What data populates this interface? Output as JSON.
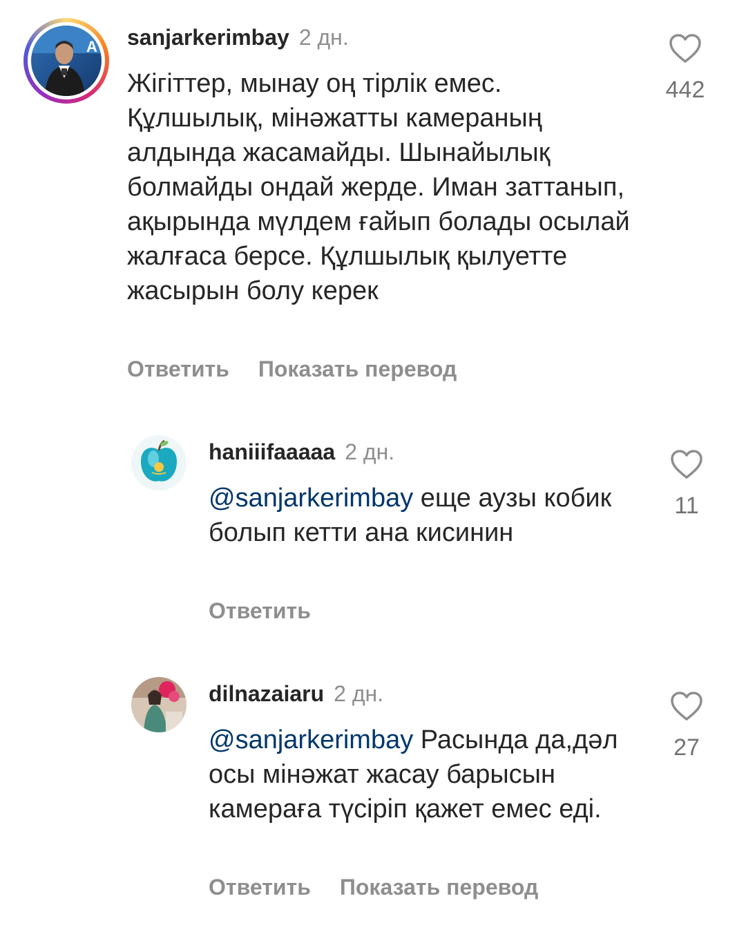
{
  "comments": [
    {
      "username": "sanjarkerimbay",
      "time": "2 дн.",
      "mention": "",
      "text": "Жігіттер, мынау оң тірлік емес. Құлшылық, мінәжатты камераның алдында жасамайды. Шынайылық болмайды ондай жерде. Иман заттанып, ақырында мүлдем ғайып болады осылай жалғаса берсе. Құлшылық қылуетте жасырын болу керек",
      "reply_label": "Ответить",
      "translate_label": "Показать перевод",
      "likes": "442",
      "avatar_icon": "avatar-speaker-photo"
    },
    {
      "username": "haniiifaaaaa",
      "time": "2 дн.",
      "mention": "@sanjarkerimbay",
      "text": "еще аузы кобик болып кетти ана кисинин",
      "reply_label": "Ответить",
      "likes": "11",
      "avatar_icon": "avatar-apple-flag"
    },
    {
      "username": "dilnazaiaru",
      "time": "2 дн.",
      "mention": "@sanjarkerimbay",
      "text": "Расында да,дәл осы мінәжат жасау барысын камераға түсіріп қажет емес еді.",
      "reply_label": "Ответить",
      "translate_label": "Показать перевод",
      "likes": "27",
      "avatar_icon": "avatar-person-photo"
    }
  ],
  "colors": {
    "text": "#262626",
    "secondary": "#8e8e8e",
    "mention": "#00376b",
    "like_count": "#737373"
  }
}
